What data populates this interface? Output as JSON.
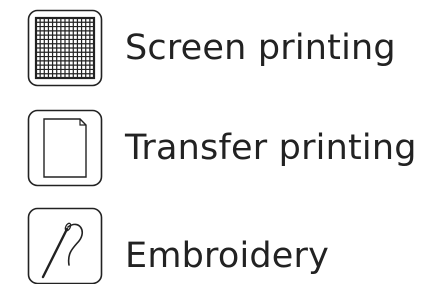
{
  "options": [
    {
      "label": "Screen printing",
      "icon": "screen-mesh-icon"
    },
    {
      "label": "Transfer printing",
      "icon": "transfer-sheet-icon"
    },
    {
      "label": "Embroidery",
      "icon": "needle-thread-icon"
    }
  ],
  "colors": {
    "icon_stroke": "#222222",
    "text": "#222222",
    "background": "#ffffff"
  }
}
